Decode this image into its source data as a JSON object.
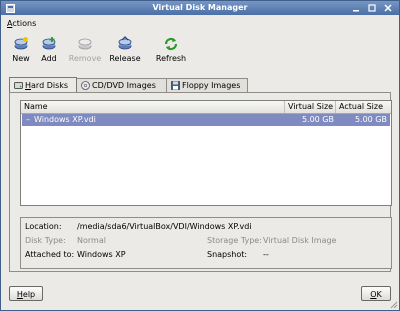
{
  "window": {
    "title": "Virtual Disk Manager"
  },
  "menu": {
    "actions_mnemonic": "A",
    "actions_rest": "ctions"
  },
  "toolbar": {
    "new_label": "New",
    "add_label": "Add",
    "remove_label": "Remove",
    "release_label": "Release",
    "refresh_label": "Refresh"
  },
  "tabs": [
    {
      "mnemonic": "H",
      "rest": "ard Disks"
    },
    {
      "label": "CD/DVD Images"
    },
    {
      "label": "Floppy Images"
    }
  ],
  "list": {
    "headers": {
      "name": "Name",
      "virtual_size": "Virtual Size",
      "actual_size": "Actual Size"
    },
    "rows": [
      {
        "expander": "–",
        "name": "Windows XP.vdi",
        "virtual_size": "5.00 GB",
        "actual_size": "5.00 GB"
      }
    ]
  },
  "details": {
    "location_label": "Location:",
    "location_value": "/media/sda6/VirtualBox/VDI/Windows XP.vdi",
    "disk_type_label": "Disk Type:",
    "disk_type_value": "Normal",
    "storage_type_label": "Storage Type:",
    "storage_type_value": "Virtual Disk Image",
    "attached_label": "Attached to:",
    "attached_value": "Windows XP",
    "snapshot_label": "Snapshot:",
    "snapshot_value": "--"
  },
  "buttons": {
    "help_mnemonic": "H",
    "help_rest": "elp",
    "ok_mnemonic": "O",
    "ok_rest": "K"
  },
  "colors": {
    "titlebar": "#4a6fa7",
    "selection": "#7f8ac0",
    "background": "#ebeae6"
  }
}
